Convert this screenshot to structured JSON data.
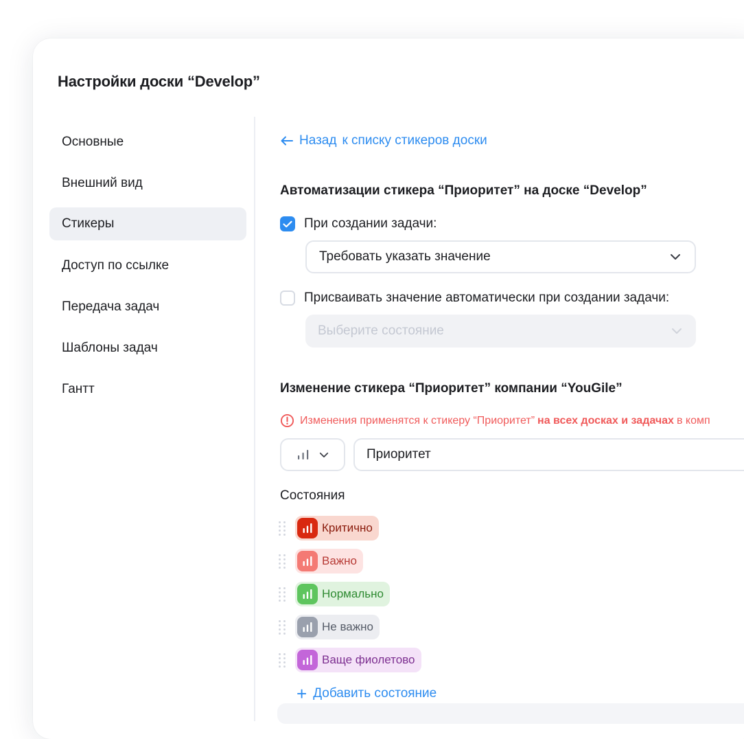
{
  "title": "Настройки доски “Develop”",
  "sidebar": {
    "items": [
      {
        "label": "Основные"
      },
      {
        "label": "Внешний вид"
      },
      {
        "label": "Стикеры"
      },
      {
        "label": "Доступ по ссылке"
      },
      {
        "label": "Передача задач"
      },
      {
        "label": "Шаблоны задач"
      },
      {
        "label": "Гантт"
      }
    ],
    "active": "Стикеры"
  },
  "back": {
    "word": "Назад",
    "label": "к списку стикеров доски"
  },
  "automation": {
    "title": "Автоматизации стикера “Приоритет” на доске “Develop”",
    "on_create": {
      "label": "При создании задачи:",
      "checked": true
    },
    "on_create_select": {
      "value": "Требовать указать значение"
    },
    "auto_assign": {
      "label": "Присваивать значение автоматически при создании задачи:",
      "checked": false
    },
    "auto_assign_select": {
      "placeholder": "Выберите состояние",
      "disabled": true
    }
  },
  "edit": {
    "title": "Изменение стикера “Приоритет” компании “YouGile”",
    "warning": {
      "before": "Изменения применятся к стикеру “Приоритет”",
      "bold": "на всех досках и задачах",
      "after": "в комп"
    },
    "icon": "bar-chart-icon",
    "name": "Приоритет",
    "states_label": "Состояния",
    "states": [
      {
        "label": "Критично",
        "color": "#d9280f",
        "bg": "#f9d7cf",
        "text": "#8a1b0c"
      },
      {
        "label": "Важно",
        "color": "#f47a74",
        "bg": "#fde3e2",
        "text": "#b73a35"
      },
      {
        "label": "Нормально",
        "color": "#5ec55e",
        "bg": "#e0f3df",
        "text": "#2e8a31"
      },
      {
        "label": "Не важно",
        "color": "#9aa0ad",
        "bg": "#ecedf1",
        "text": "#555b67"
      },
      {
        "label": "Ваще фиолетово",
        "color": "#c366d9",
        "bg": "#f4e2f8",
        "text": "#7c2e90"
      }
    ],
    "add_state": "Добавить состояние"
  },
  "colors": {
    "accent": "#2d8cf0",
    "warning": "#f05a5a"
  }
}
